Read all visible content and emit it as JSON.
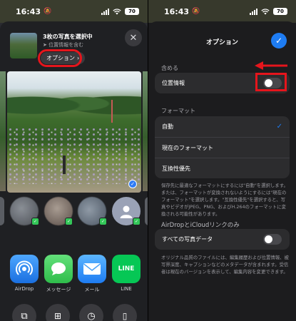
{
  "status_bar": {
    "time_left": "16:43",
    "time_right": "16:43",
    "battery": "70"
  },
  "share_sheet": {
    "selection_title": "3枚の写真を選択中",
    "selection_subtitle": "位置情報を含む",
    "options_button": "オプション",
    "apps": [
      {
        "label": "AirDrop"
      },
      {
        "label": "メッセージ"
      },
      {
        "label": "メール"
      },
      {
        "label": "LINE",
        "icon_text": "LINE"
      }
    ]
  },
  "options": {
    "title": "オプション",
    "include_section": "含める",
    "location_label": "位置情報",
    "location_enabled": false,
    "format_section": "フォーマット",
    "format_options": [
      "自動",
      "現在のフォーマット",
      "互換性優先"
    ],
    "selected_format": "自動",
    "format_note": "保存先に最適なフォーマットにするには\"自動\"を選択します。または、フォーマットが変換されないようにするには\"現在のフォーマット\"を選択します。\"互換性優先\"を選択すると、写真やビデオがJPEG、PNG、およびH.264のフォーマットに変換される可能性があります。",
    "airdrop_section": "AirDropとiCloudリンクのみ",
    "all_data_label": "すべての写真データ",
    "all_data_enabled": false,
    "airdrop_note": "オリジナル品質のファイルには、編集履歴および位置情報、被写界深度、キャプションなどのメタデータが含まれます。受信者は現在のバージョンを表示して、編集内容を変更できます。"
  },
  "colors": {
    "accent": "#1e7cf2",
    "highlight": "#e5151c"
  }
}
